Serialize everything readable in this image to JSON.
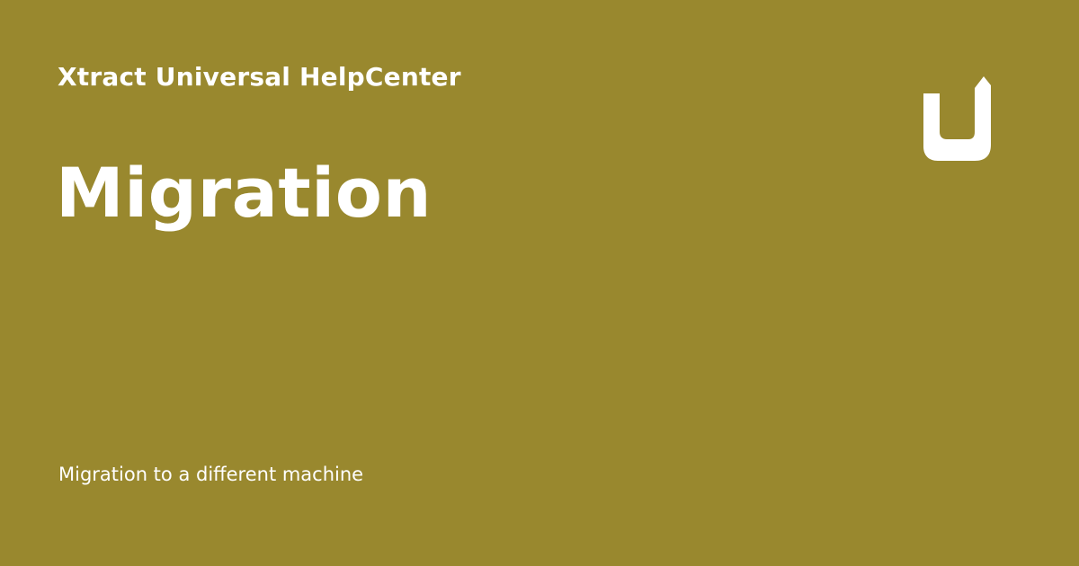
{
  "site": {
    "name": "Xtract Universal HelpCenter"
  },
  "page": {
    "title": "Migration",
    "description": "Migration to a different machine"
  },
  "logo": {
    "icon": "u-logo-icon"
  },
  "colors": {
    "background": "#99882e",
    "text": "#ffffff"
  }
}
